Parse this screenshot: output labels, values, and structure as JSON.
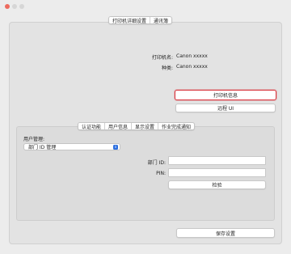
{
  "window": {
    "traffic_lights": [
      "close",
      "minimize",
      "maximize"
    ]
  },
  "top_tabs": [
    {
      "label": "打印机详细设置",
      "active": true
    },
    {
      "label": "通讯簿",
      "active": false
    }
  ],
  "printer_info": {
    "name_label": "打印机名:",
    "name_value": "Canon xxxxx",
    "type_label": "种类:",
    "type_value": "Canon xxxxx"
  },
  "buttons": {
    "printer_info": "打印机信息",
    "remote_ui": "远程 UI",
    "verify": "检验",
    "save_settings": "保存设置"
  },
  "inner_tabs": [
    {
      "label": "认证功能",
      "active": true
    },
    {
      "label": "用户信息",
      "active": false
    },
    {
      "label": "显示设置",
      "active": false
    },
    {
      "label": "作业完成通知",
      "active": false
    }
  ],
  "auth": {
    "user_mgmt_label": "用户管理:",
    "user_mgmt_selected": "部门 ID 管理",
    "dept_id_label": "部门 ID:",
    "dept_id_value": "",
    "pin_label": "PIN:",
    "pin_value": ""
  },
  "colors": {
    "accent_blue": "#2c6fe0",
    "focus_red": "#d9363e",
    "close_red": "#ed6a5e"
  }
}
